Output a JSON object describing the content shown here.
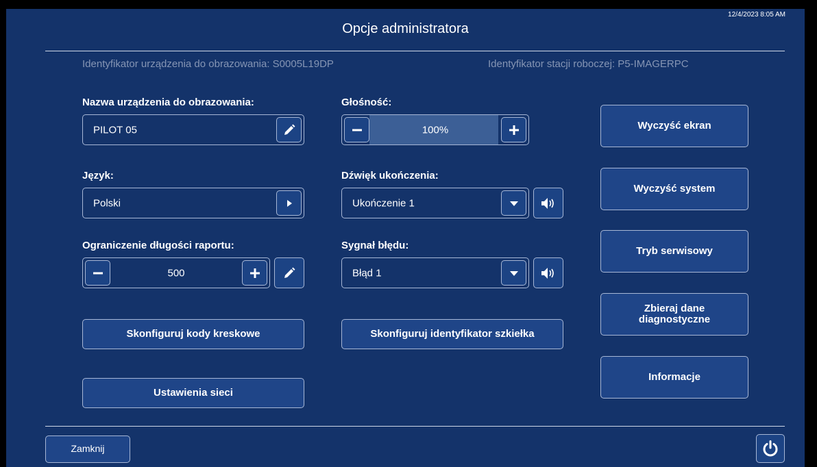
{
  "header": {
    "timestamp": "12/4/2023 8:05 AM",
    "title": "Opcje administratora",
    "device_id": "Identyfikator urządzenia do obrazowania: S0005L19DP",
    "workstation_id": "Identyfikator stacji roboczej: P5-IMAGERPC"
  },
  "device_name": {
    "label": "Nazwa urządzenia do obrazowania:",
    "value": "PILOT 05"
  },
  "language": {
    "label": "Język:",
    "value": "Polski"
  },
  "report_limit": {
    "label": "Ograniczenie długości raportu:",
    "value": "500"
  },
  "volume": {
    "label": "Głośność:",
    "value": "100%",
    "level_percent": 100
  },
  "completion_sound": {
    "label": "Dźwięk ukończenia:",
    "value": "Ukończenie 1"
  },
  "error_signal": {
    "label": "Sygnał błędu:",
    "value": "Błąd 1"
  },
  "buttons": {
    "configure_barcodes": "Skonfiguruj kody kreskowe",
    "network_settings": "Ustawienia sieci",
    "configure_slide_id": "Skonfiguruj identyfikator szkiełka",
    "clear_screen": "Wyczyść ekran",
    "clear_system": "Wyczyść system",
    "service_mode": "Tryb serwisowy",
    "collect_diagnostics": "Zbieraj dane diagnostyczne",
    "information": "Informacje"
  },
  "footer": {
    "close_label": "Zamknij"
  },
  "icons": {
    "edit": "pencil-icon",
    "arrow_right": "chevron-right-icon",
    "dropdown": "chevron-down-icon",
    "speaker": "speaker-icon",
    "power": "power-icon",
    "minus": "minus-icon",
    "plus": "plus-icon"
  },
  "colors": {
    "background": "#14336a",
    "button": "#1f4588",
    "border": "#a7b7d6",
    "muted_text": "#8595b4"
  }
}
